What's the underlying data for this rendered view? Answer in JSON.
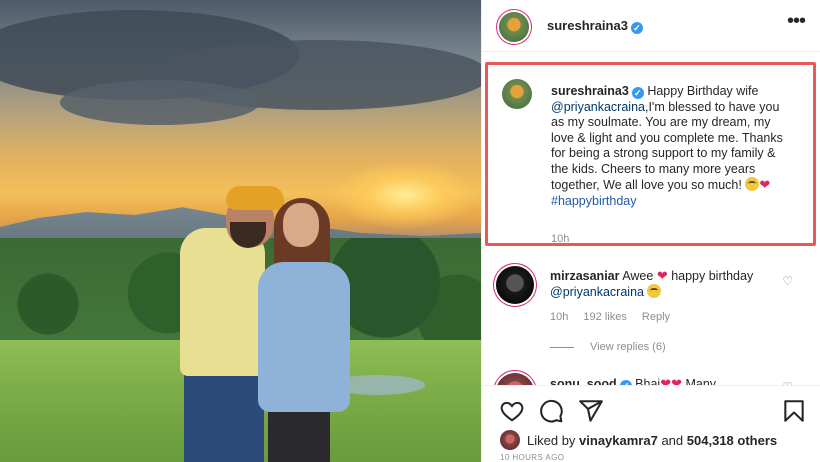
{
  "post": {
    "username": "sureshraina3",
    "more_label": "•••"
  },
  "caption": {
    "username": "sureshraina3",
    "text_intro": "Happy Birthday wife",
    "mention": "@priyankacraina",
    "text_body": ",I'm blessed to have you as my soulmate. You are my dream, my love & light and you complete me. Thanks for being a strong support to my family & the kids. Cheers to many more years together, We all love you so much!",
    "hashtag": "#happybirthday",
    "time": "10h"
  },
  "comments": [
    {
      "username": "mirzasaniar",
      "text_a": "Awee",
      "text_b": "happy birthday",
      "mention": "@priyankacraina",
      "time": "10h",
      "likes": "192 likes",
      "reply": "Reply",
      "view_replies": "View replies (6)"
    },
    {
      "username": "sonu_sood",
      "text": "Bhai",
      "text_more": "Many"
    }
  ],
  "likes": {
    "prefix": "Liked by",
    "user": "vinaykamra7",
    "middle": "and",
    "count": "504,318 others"
  },
  "posted_ago": "10 HOURS AGO",
  "icons": [
    "heart-icon",
    "comment-icon",
    "share-icon",
    "bookmark-icon",
    "more-icon",
    "verified-icon"
  ],
  "colors": {
    "highlight_border": "#e9595b",
    "verified": "#3897f0",
    "link": "#00376b",
    "heart": "#e0245e"
  }
}
